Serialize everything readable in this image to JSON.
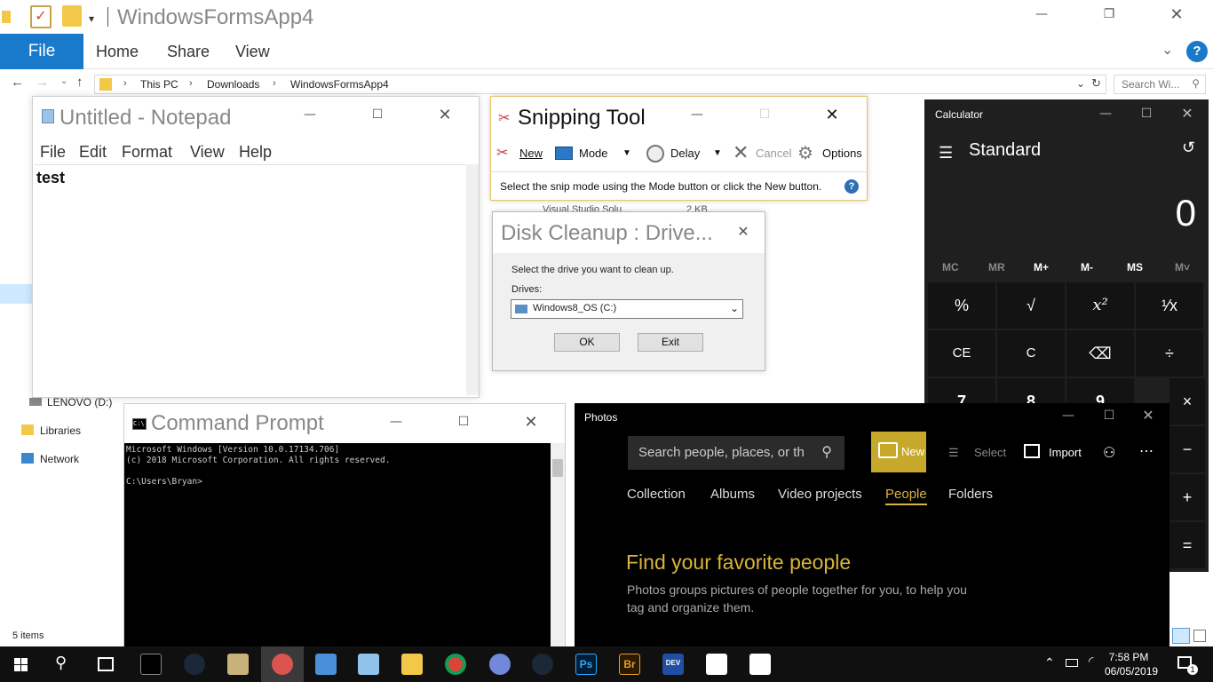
{
  "explorer": {
    "title": "WindowsFormsApp4",
    "ribbon": {
      "file": "File",
      "tabs": [
        "Home",
        "Share",
        "View"
      ]
    },
    "breadcrumb": [
      "This PC",
      "Downloads",
      "WindowsFormsApp4"
    ],
    "search_placeholder": "Search Wi...",
    "nav": {
      "drive": "LENOVO (D:)",
      "libraries": "Libraries",
      "network": "Network"
    },
    "status": "5 items",
    "partial_file_text": "Visual Studio Solu...",
    "partial_size": "2 KB"
  },
  "notepad": {
    "title": "Untitled - Notepad",
    "menu": [
      "File",
      "Edit",
      "Format",
      "View",
      "Help"
    ],
    "content": "test"
  },
  "snipping": {
    "title": "Snipping Tool",
    "buttons": {
      "new": "New",
      "mode": "Mode",
      "delay": "Delay",
      "cancel": "Cancel",
      "options": "Options"
    },
    "hint": "Select the snip mode using the Mode button or click the New button."
  },
  "disk_cleanup": {
    "title": "Disk Cleanup : Drive...",
    "prompt": "Select the drive you want to clean up.",
    "drives_label": "Drives:",
    "selected_drive": "Windows8_OS (C:)",
    "ok": "OK",
    "exit": "Exit"
  },
  "calculator": {
    "app_name": "Calculator",
    "mode": "Standard",
    "display": "0",
    "memory": [
      "MC",
      "MR",
      "M+",
      "M-",
      "MS",
      "M˅"
    ],
    "keys_row1": [
      "%",
      "√",
      "x²",
      "¹⁄x"
    ],
    "keys_row2": [
      "CE",
      "C",
      "⌫",
      "÷"
    ],
    "keys_row3": [
      "7",
      "8",
      "9",
      "×"
    ],
    "side_ops": [
      "−",
      "+",
      "="
    ]
  },
  "cmd": {
    "title": "Command Prompt",
    "lines": "Microsoft Windows [Version 10.0.17134.706]\n(c) 2018 Microsoft Corporation. All rights reserved.\n\nC:\\Users\\Bryan>"
  },
  "photos": {
    "app_name": "Photos",
    "search_placeholder": "Search people, places, or th",
    "new": "New",
    "select": "Select",
    "import": "Import",
    "tabs": [
      "Collection",
      "Albums",
      "Video projects",
      "People",
      "Folders"
    ],
    "active_tab": "People",
    "headline": "Find your favorite people",
    "subtext": "Photos groups pictures of people together for you, to help you tag and organize them.",
    "accent": "#c6a82b"
  },
  "taskbar": {
    "time": "7:58 PM",
    "date": "06/05/2019",
    "notification_count": "1"
  }
}
